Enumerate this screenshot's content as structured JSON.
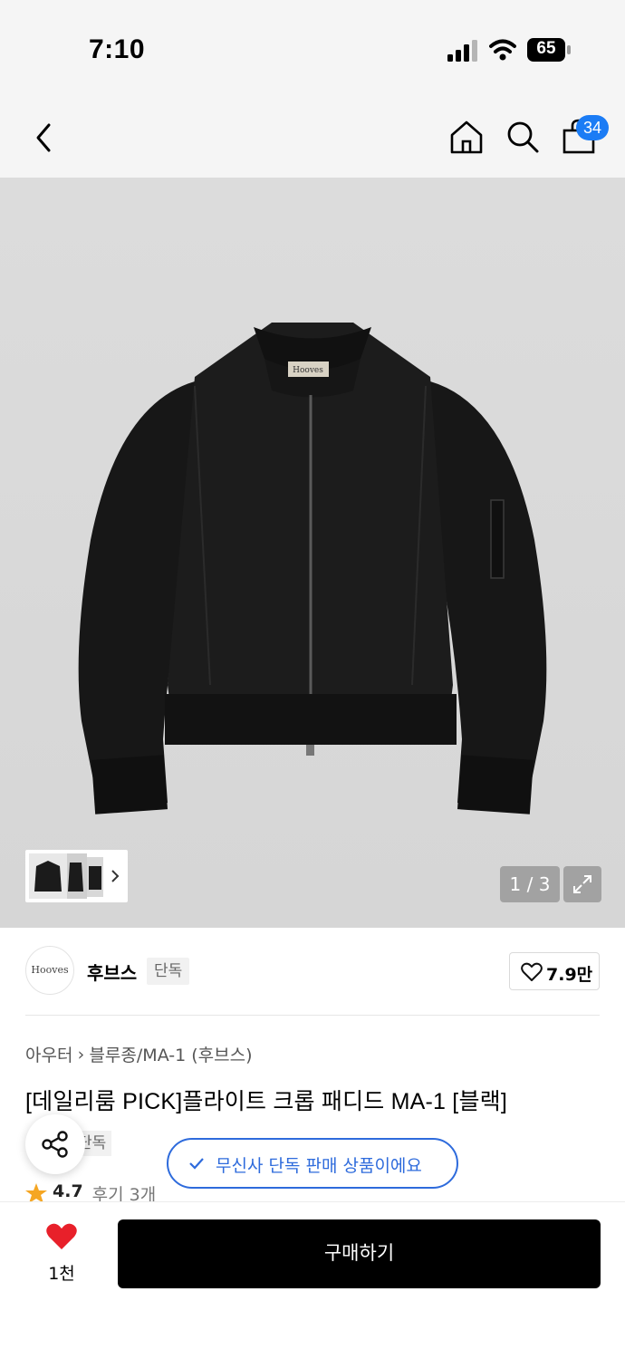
{
  "status_bar": {
    "time": "7:10",
    "battery_level": "65"
  },
  "header": {
    "cart_count": "34",
    "icons": [
      "back-icon",
      "home-icon",
      "search-icon",
      "cart-icon"
    ]
  },
  "gallery": {
    "counter": "1 / 3",
    "icons": [
      "expand-icon",
      "chevron-right-icon"
    ]
  },
  "brand": {
    "logo_text": "Hooves",
    "name": "후브스",
    "tag": "단독",
    "likes": "7.9만"
  },
  "product": {
    "breadcrumb": [
      "아우터",
      "블루종/MA-1 (후브스)"
    ],
    "title": "[데일리룸 PICK]플라이트 크롭 패디드 MA-1 [블랙]",
    "tag_partial": "단독",
    "exclusive_notice": "무신사 단독 판매 상품이에요",
    "rating": "4.7",
    "reviews": "후기 3개"
  },
  "bottom_bar": {
    "wish_count": "1천",
    "buy_label": "구매하기"
  },
  "colors": {
    "accent_blue": "#1b7cf5",
    "pill_blue": "#2e6bdc",
    "heart_red": "#e8202a",
    "star_orange": "#f5a623"
  }
}
